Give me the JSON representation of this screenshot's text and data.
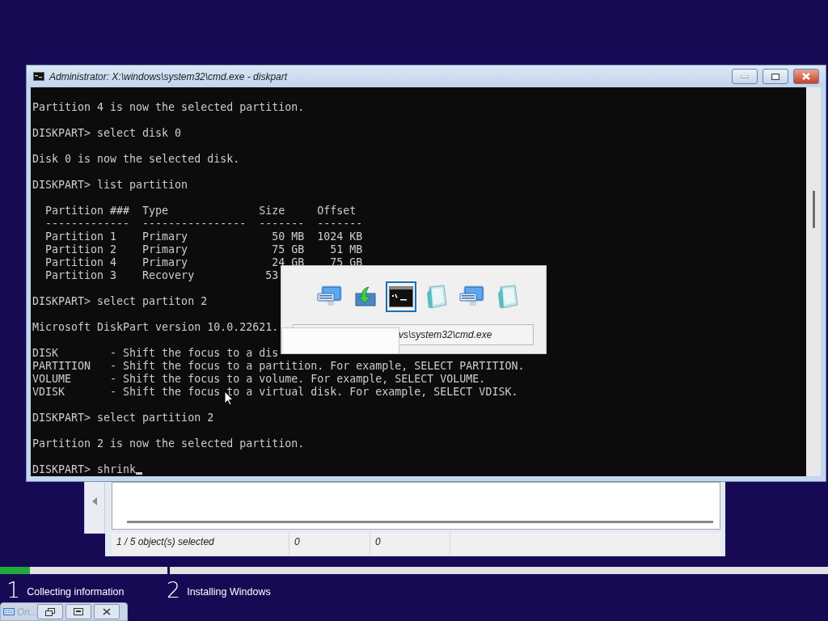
{
  "console_window": {
    "title": "Administrator: X:\\windows\\system32\\cmd.exe - diskpart",
    "blocks": [
      [
        "Partition 4 is now the selected partition."
      ],
      [
        "DISKPART> select disk 0"
      ],
      [
        "Disk 0 is now the selected disk."
      ],
      [
        "DISKPART> list partition"
      ],
      [
        "  Partition ###  Type              Size     Offset",
        "  -------------  ----------------  -------  -------",
        "  Partition 1    Primary             50 MB  1024 KB",
        "  Partition 2    Primary             75 GB    51 MB",
        "  Partition 4    Primary             24 GB    75 GB",
        "  Partition 3    Recovery           53"
      ],
      [
        "DISKPART> select partiton 2"
      ],
      [
        "Microsoft DiskPart version 10.0.22621."
      ],
      [
        "DISK        - Shift the focus to a dis",
        "PARTITION   - Shift the focus to a partition. For example, SELECT PARTITION.",
        "VOLUME      - Shift the focus to a volume. For example, SELECT VOLUME.",
        "VDISK       - Shift the focus to a virtual disk. For example, SELECT VDISK."
      ],
      [
        "DISKPART> select partition 2"
      ],
      [
        "Partition 2 is now the selected partition."
      ],
      [
        "DISKPART> shrink"
      ]
    ]
  },
  "task_switcher": {
    "items": [
      {
        "kind": "monitor",
        "selected": false
      },
      {
        "kind": "install",
        "selected": false
      },
      {
        "kind": "console",
        "selected": true
      },
      {
        "kind": "notepad",
        "selected": false
      },
      {
        "kind": "monitor",
        "selected": false
      },
      {
        "kind": "notepad",
        "selected": false
      }
    ],
    "path": "vs\\system32\\cmd.exe"
  },
  "explorer_window": {
    "status": [
      "1 / 5 object(s) selected",
      "0",
      "0"
    ]
  },
  "setup": {
    "steps": [
      {
        "number": "1",
        "label": "Collecting information",
        "level": 0.18
      },
      {
        "number": "2",
        "label": "Installing Windows"
      }
    ]
  },
  "keyboard_bar": {
    "title": "On..."
  }
}
